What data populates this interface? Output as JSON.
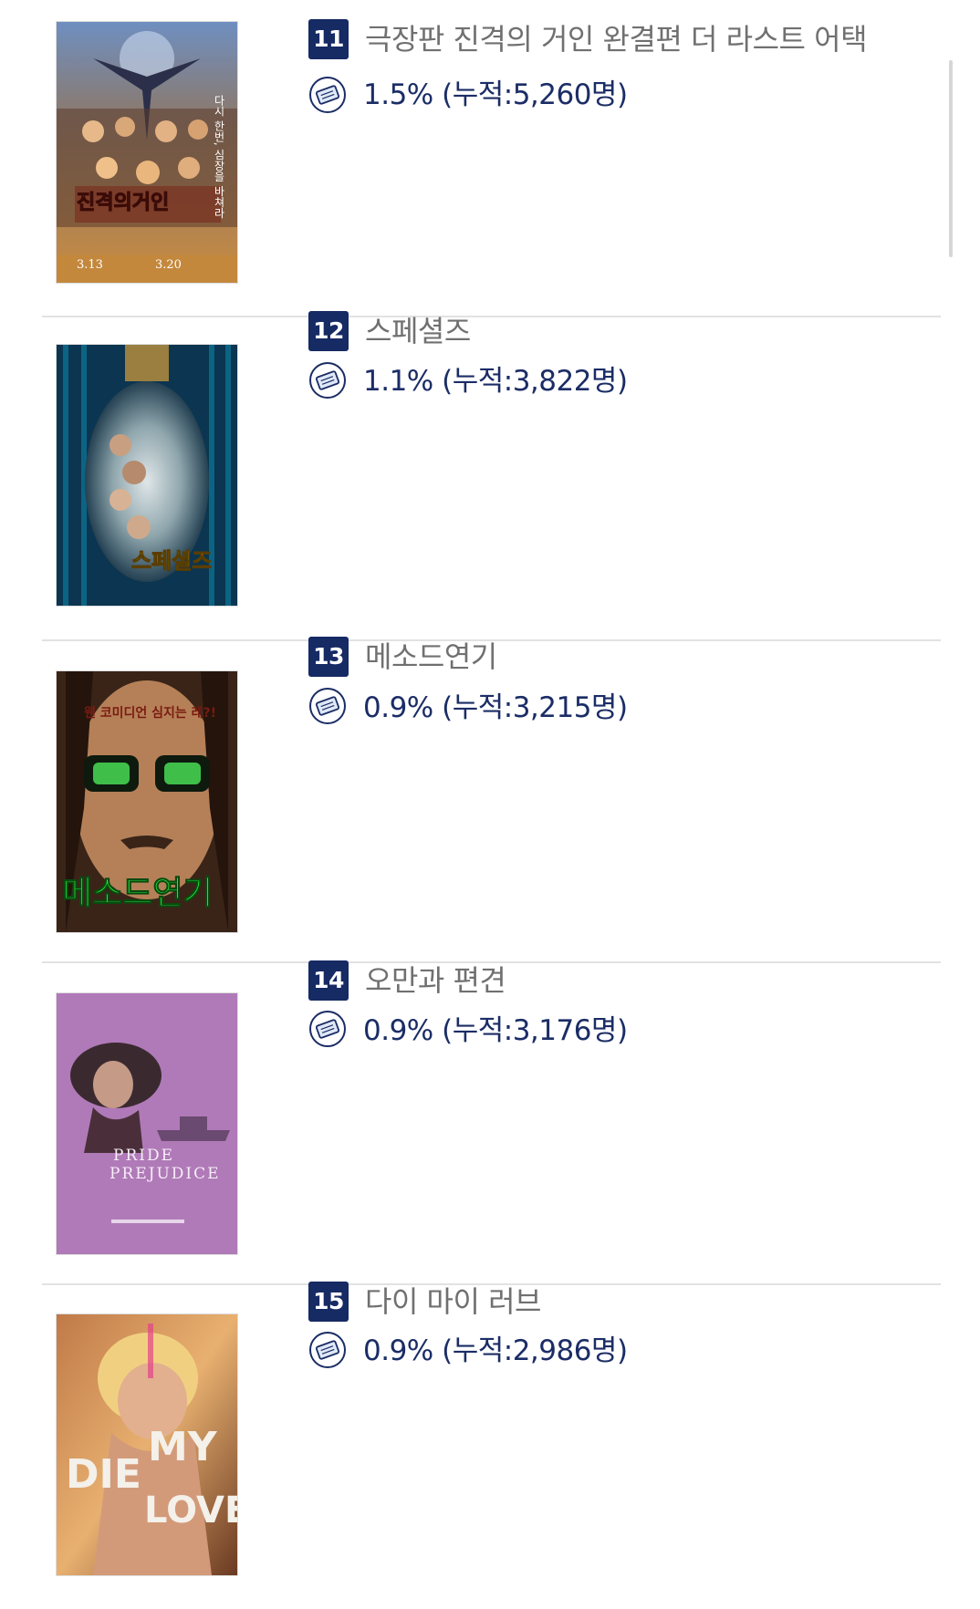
{
  "movies": [
    {
      "rank": "11",
      "title": "극장판 진격의 거인 완결편 더 라스트 어택",
      "stat": "1.5% (누적:5,260명)",
      "poster": {
        "title_art": "진격의거인",
        "tagline": "다시 한번, 심장을 바쳐라",
        "date1": "3.13",
        "date2": "3.20"
      }
    },
    {
      "rank": "12",
      "title": "스페셜즈",
      "stat": "1.1% (누적:3,822명)",
      "poster": {
        "title_art": "스페셜즈"
      }
    },
    {
      "rank": "13",
      "title": "메소드연기",
      "stat": "0.9% (누적:3,215명)",
      "poster": {
        "title_art": "메소드연기",
        "top_text": "웬 코미디언 심지는 레?!"
      }
    },
    {
      "rank": "14",
      "title": "오만과 편견",
      "stat": "0.9% (누적:3,176명)",
      "poster": {
        "title_art_1": "PRIDE",
        "title_art_2": "PREJUDICE"
      }
    },
    {
      "rank": "15",
      "title": "다이 마이 러브",
      "stat": "0.9% (누적:2,986명)",
      "poster": {
        "title_art_1": "DIE",
        "title_art_2": "MY",
        "title_art_3": "LOVE"
      }
    }
  ],
  "icons": {
    "stat_icon": "ticket-icon"
  },
  "colors": {
    "rank_badge": "#162a63",
    "stat_text": "#1b2d66",
    "title_text": "#707070",
    "divider": "#e2e2e2"
  }
}
